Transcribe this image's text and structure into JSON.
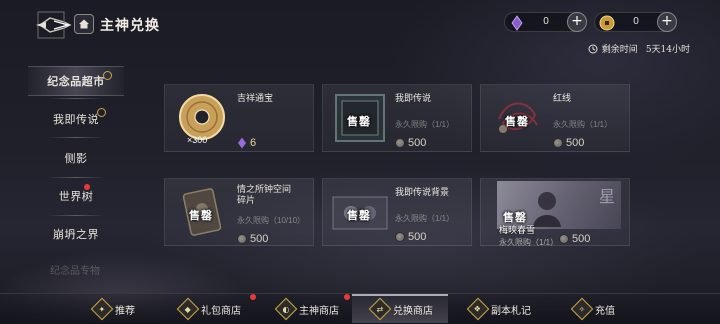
{
  "header": {
    "title": "主神兑换",
    "logo_icon": "winged-emblem-icon",
    "home_icon": "home-icon"
  },
  "currencies": [
    {
      "name": "purple-crystal",
      "icon": "purple-crystal-icon",
      "value": "0",
      "plus": "+"
    },
    {
      "name": "gold-coin",
      "icon": "gold-coin-icon",
      "value": "0",
      "plus": "+"
    }
  ],
  "timer": {
    "label": "剩余时间",
    "value": "5天14小时"
  },
  "sidebar": {
    "items": [
      {
        "label": "纪念品超市",
        "active": true,
        "clock": true,
        "dot": false
      },
      {
        "label": "我即传说",
        "active": false,
        "clock": true,
        "dot": false
      },
      {
        "label": "侧影",
        "active": false,
        "clock": false,
        "dot": false
      },
      {
        "label": "世界树",
        "active": false,
        "clock": false,
        "dot": true
      },
      {
        "label": "崩坍之界",
        "active": false,
        "clock": false,
        "dot": false
      }
    ],
    "faded_label": "纪念品专物"
  },
  "shop": {
    "sold_label": "售罄",
    "items": [
      {
        "name": "吉祥通宝",
        "quantity": "×300",
        "price": "6",
        "currency": "purple-crystal",
        "limit": "",
        "sold": false
      },
      {
        "name": "我即传说",
        "limit": "永久限购（1/1）",
        "price": "500",
        "currency": "silver-coin",
        "sold": true
      },
      {
        "name": "红线",
        "limit": "永久限购（1/1）",
        "price": "500",
        "currency": "silver-coin",
        "sold": true
      },
      {
        "name": "情之所钟空间碎片",
        "name_line1": "情之所钟空间",
        "name_line2": "碎片",
        "limit": "永久限购（10/10）",
        "price": "500",
        "currency": "silver-coin",
        "sold": true
      },
      {
        "name": "我即传说背景",
        "limit": "永久限购（1/1）",
        "price": "500",
        "currency": "silver-coin",
        "sold": true
      },
      {
        "name": "梅映春雪",
        "limit": "永久限购（1/1）",
        "price": "500",
        "currency": "silver-coin",
        "sold": true,
        "thumb_text": "星"
      }
    ]
  },
  "bottom_nav": [
    {
      "label": "推荐",
      "icon": "recommend-icon",
      "glyph": "✦",
      "active": false,
      "dot": false
    },
    {
      "label": "礼包商店",
      "icon": "gift-icon",
      "glyph": "◆",
      "active": false,
      "dot": true
    },
    {
      "label": "主神商店",
      "icon": "main-god-icon",
      "glyph": "◐",
      "active": false,
      "dot": true
    },
    {
      "label": "兑换商店",
      "icon": "exchange-icon",
      "glyph": "⇄",
      "active": true,
      "dot": false
    },
    {
      "label": "副本札记",
      "icon": "notes-icon",
      "glyph": "❖",
      "active": false,
      "dot": false
    },
    {
      "label": "充值",
      "icon": "recharge-icon",
      "glyph": "✧",
      "active": false,
      "dot": false
    }
  ]
}
